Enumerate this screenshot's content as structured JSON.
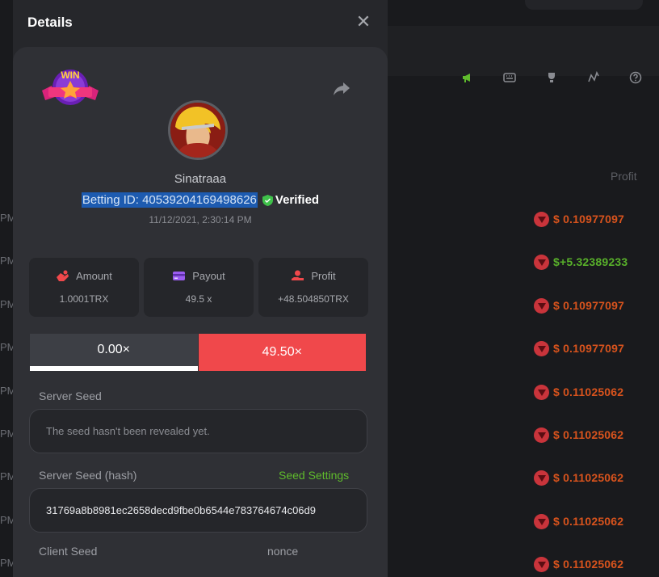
{
  "modal": {
    "title": "Details",
    "username": "Sinatraaa",
    "betting_id": "Betting ID: 405392041694986​26",
    "verified_label": "Verified",
    "timestamp": "11/12/2021, 2:30:14 PM",
    "badge_text": "WIN"
  },
  "stats": [
    {
      "label": "Amount",
      "value": "1.0001TRX"
    },
    {
      "label": "Payout",
      "value": "49.5 x"
    },
    {
      "label": "Profit",
      "value": "+48.504850TRX"
    }
  ],
  "multipliers": {
    "left": "0.00×",
    "right": "49.50×"
  },
  "seeds": {
    "server_seed_label": "Server Seed",
    "server_seed_value": "The seed hasn't been revealed yet.",
    "server_hash_label": "Server Seed (hash)",
    "seed_settings_label": "Seed Settings",
    "server_hash_value": "31769a8b8981ec2658decd9fbe0b6544e783764674c06d9",
    "client_seed_label": "Client Seed",
    "nonce_label": "nonce"
  },
  "background": {
    "profit_header": "Profit",
    "rows": [
      {
        "prefix": "PM",
        "amount": "$ 0.10977097",
        "win": false
      },
      {
        "prefix": "PM",
        "amount": "$+5.32389233",
        "win": true
      },
      {
        "prefix": "PM",
        "amount": "$ 0.10977097",
        "win": false
      },
      {
        "prefix": "PM",
        "amount": "$ 0.10977097",
        "win": false
      },
      {
        "prefix": "PM",
        "amount": "$ 0.11025062",
        "win": false
      },
      {
        "prefix": "PM",
        "amount": "$ 0.11025062",
        "win": false
      },
      {
        "prefix": "PM",
        "amount": "$ 0.11025062",
        "win": false
      },
      {
        "prefix": "PM",
        "amount": "$ 0.11025062",
        "win": false
      },
      {
        "prefix": "PM",
        "amount": "$ 0.11025062",
        "win": false
      }
    ]
  },
  "colors": {
    "accent_red": "#f0484b",
    "accent_green": "#5fbb2c",
    "loss_orange": "#d8531d"
  }
}
